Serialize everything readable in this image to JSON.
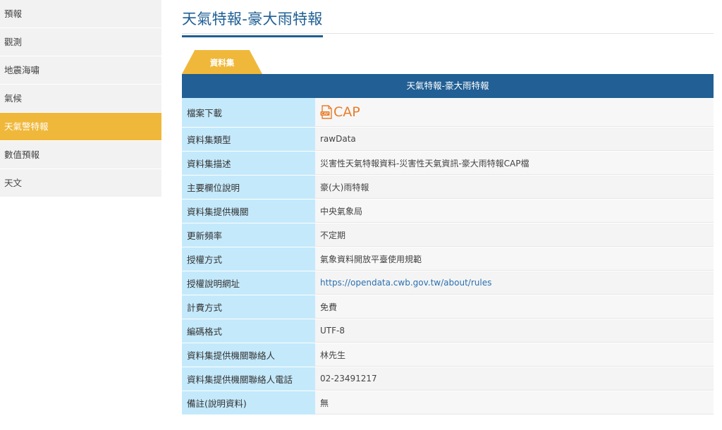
{
  "sidebar": {
    "items": [
      {
        "label": "預報",
        "active": false
      },
      {
        "label": "觀測",
        "active": false
      },
      {
        "label": "地震海嘯",
        "active": false
      },
      {
        "label": "氣候",
        "active": false
      },
      {
        "label": "天氣警特報",
        "active": true
      },
      {
        "label": "數值預報",
        "active": false
      },
      {
        "label": "天文",
        "active": false
      }
    ]
  },
  "page": {
    "title": "天氣特報-豪大雨特報",
    "tab_label": "資料集",
    "table_title": "天氣特報-豪大雨特報"
  },
  "table": {
    "download_label": "檔案下載",
    "download_link": "CAP",
    "rows": [
      {
        "label": "資料集類型",
        "value": "rawData"
      },
      {
        "label": "資料集描述",
        "value": "災害性天氣特報資料-災害性天氣資訊-豪大雨特報CAP檔"
      },
      {
        "label": "主要欄位說明",
        "value": "豪(大)雨特報"
      },
      {
        "label": "資料集提供機關",
        "value": "中央氣象局"
      },
      {
        "label": "更新頻率",
        "value": "不定期"
      },
      {
        "label": "授權方式",
        "value": "氣象資料開放平臺使用規範"
      },
      {
        "label": "授權說明網址",
        "value": "https://opendata.cwb.gov.tw/about/rules"
      },
      {
        "label": "計費方式",
        "value": "免費"
      },
      {
        "label": "編碼格式",
        "value": "UTF-8"
      },
      {
        "label": "資料集提供機關聯絡人",
        "value": "林先生"
      },
      {
        "label": "資料集提供機關聯絡人電話",
        "value": "02-23491217"
      },
      {
        "label": "備註(說明資料)",
        "value": "無"
      }
    ]
  },
  "colors": {
    "accent": "#f0b83a",
    "header_blue": "#215f94",
    "label_bg": "#c4e9fb",
    "link": "#2a70b0",
    "cap": "#e87d2b"
  },
  "icons": {
    "download": "cap-file-icon"
  }
}
